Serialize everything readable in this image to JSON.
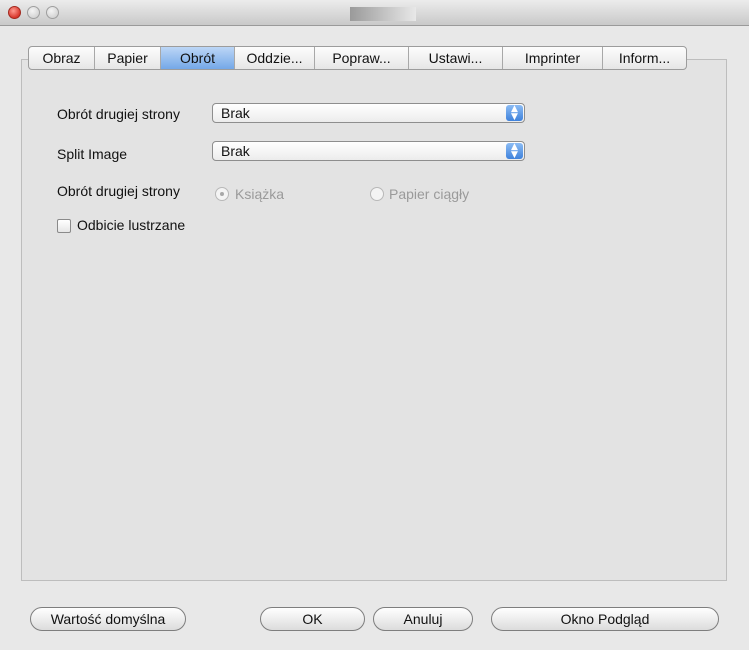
{
  "tabs": [
    {
      "label": "Obraz"
    },
    {
      "label": "Papier"
    },
    {
      "label": "Obrót"
    },
    {
      "label": "Oddzie..."
    },
    {
      "label": "Popraw..."
    },
    {
      "label": "Ustawi..."
    },
    {
      "label": "Imprinter"
    },
    {
      "label": "Inform..."
    }
  ],
  "active_tab": "Obrót",
  "form": {
    "rotation_label": "Obrót drugiej strony",
    "rotation_value": "Brak",
    "split_label": "Split Image",
    "split_value": "Brak",
    "binding_label": "Obrót drugiej strony",
    "binding_options": [
      "Książka",
      "Papier ciągły"
    ],
    "binding_selected": "Książka",
    "mirror_label": "Odbicie lustrzane",
    "mirror_checked": false
  },
  "buttons": {
    "defaults": "Wartość domyślna",
    "ok": "OK",
    "cancel": "Anuluj",
    "preview": "Okno Podgląd"
  },
  "colors": {
    "tab_active": "#74a8e8",
    "close_button": "#d8372c"
  }
}
